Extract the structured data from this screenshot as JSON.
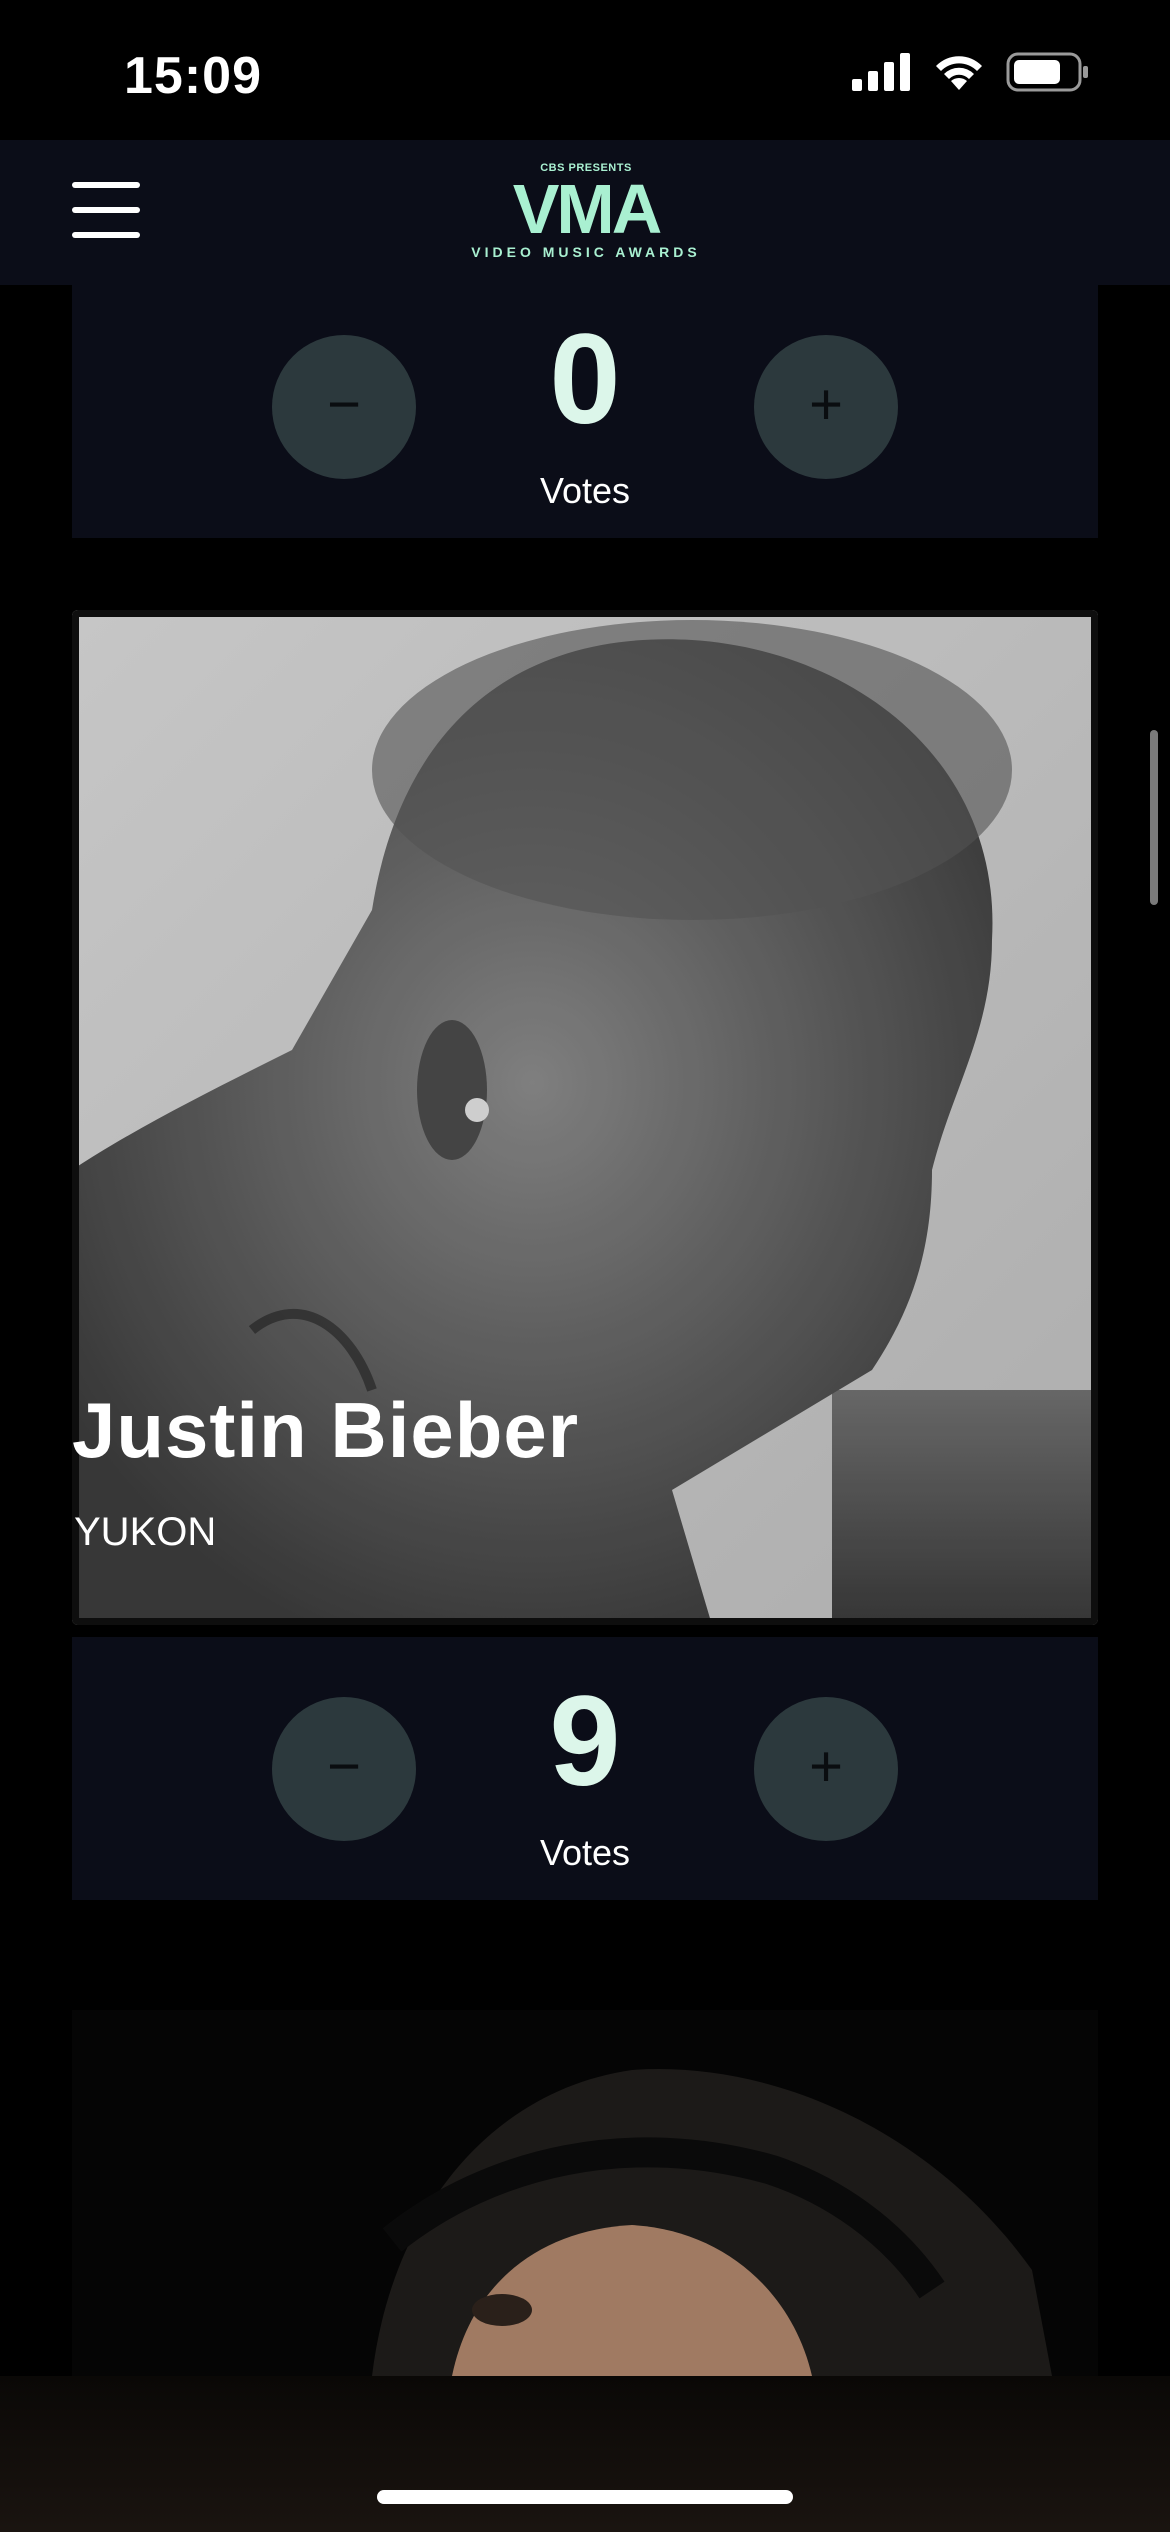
{
  "status_bar": {
    "time": "15:09",
    "icons": [
      "cellular-signal-icon",
      "wifi-icon",
      "battery-icon"
    ]
  },
  "header": {
    "menu_icon": "hamburger-menu-icon",
    "logo": {
      "top_text": "CBS PRESENTS",
      "main_text": "VMA",
      "sub_text": "VIDEO MUSIC AWARDS",
      "color": "#a9f0d1"
    }
  },
  "vote_panels": [
    {
      "minus_label": "−",
      "plus_label": "+",
      "count": "0",
      "label": "Votes"
    },
    {
      "minus_label": "−",
      "plus_label": "+",
      "count": "9",
      "label": "Votes"
    }
  ],
  "nominee": {
    "name": "Justin Bieber",
    "song": "YUKON"
  },
  "colors": {
    "panel_bg": "#0b0d18",
    "count_color": "#dcf6ea",
    "button_bg": "#2c393d"
  }
}
